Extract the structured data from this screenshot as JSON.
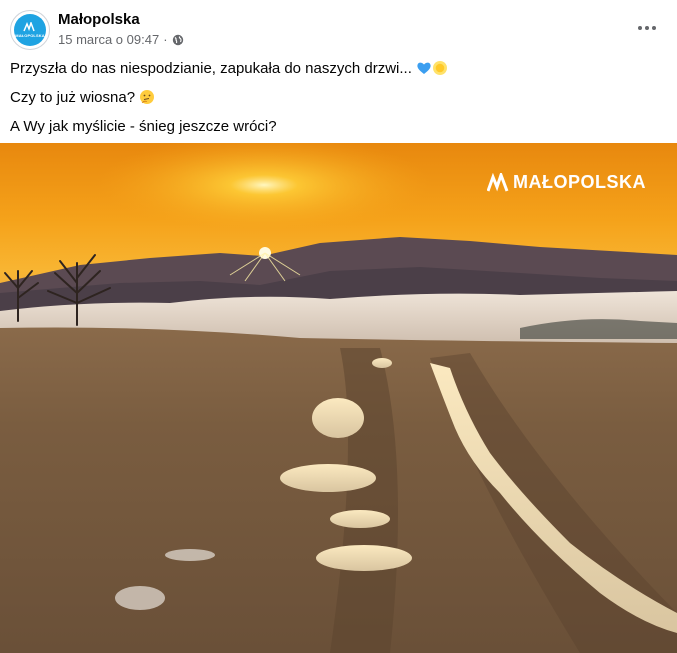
{
  "post": {
    "page_name": "Małopolska",
    "timestamp": "15 marca o 09:47",
    "separator": "·",
    "privacy_icon": "globe-icon",
    "more_icon": "more-horizontal-icon",
    "avatar_label": "MAŁOPOLSKA",
    "lines": [
      "Przyszła do nas niespodzianie, zapukała do naszych drzwi...",
      "Czy to już wiosna?",
      "A Wy jak myślicie - śnieg jeszcze wróci?"
    ],
    "emojis": [
      "blue-heart-icon",
      "sun-icon",
      "thinking-face-icon"
    ]
  },
  "photo": {
    "watermark": "MAŁOPOLSKA",
    "brand_color": "#1fa3e2"
  }
}
